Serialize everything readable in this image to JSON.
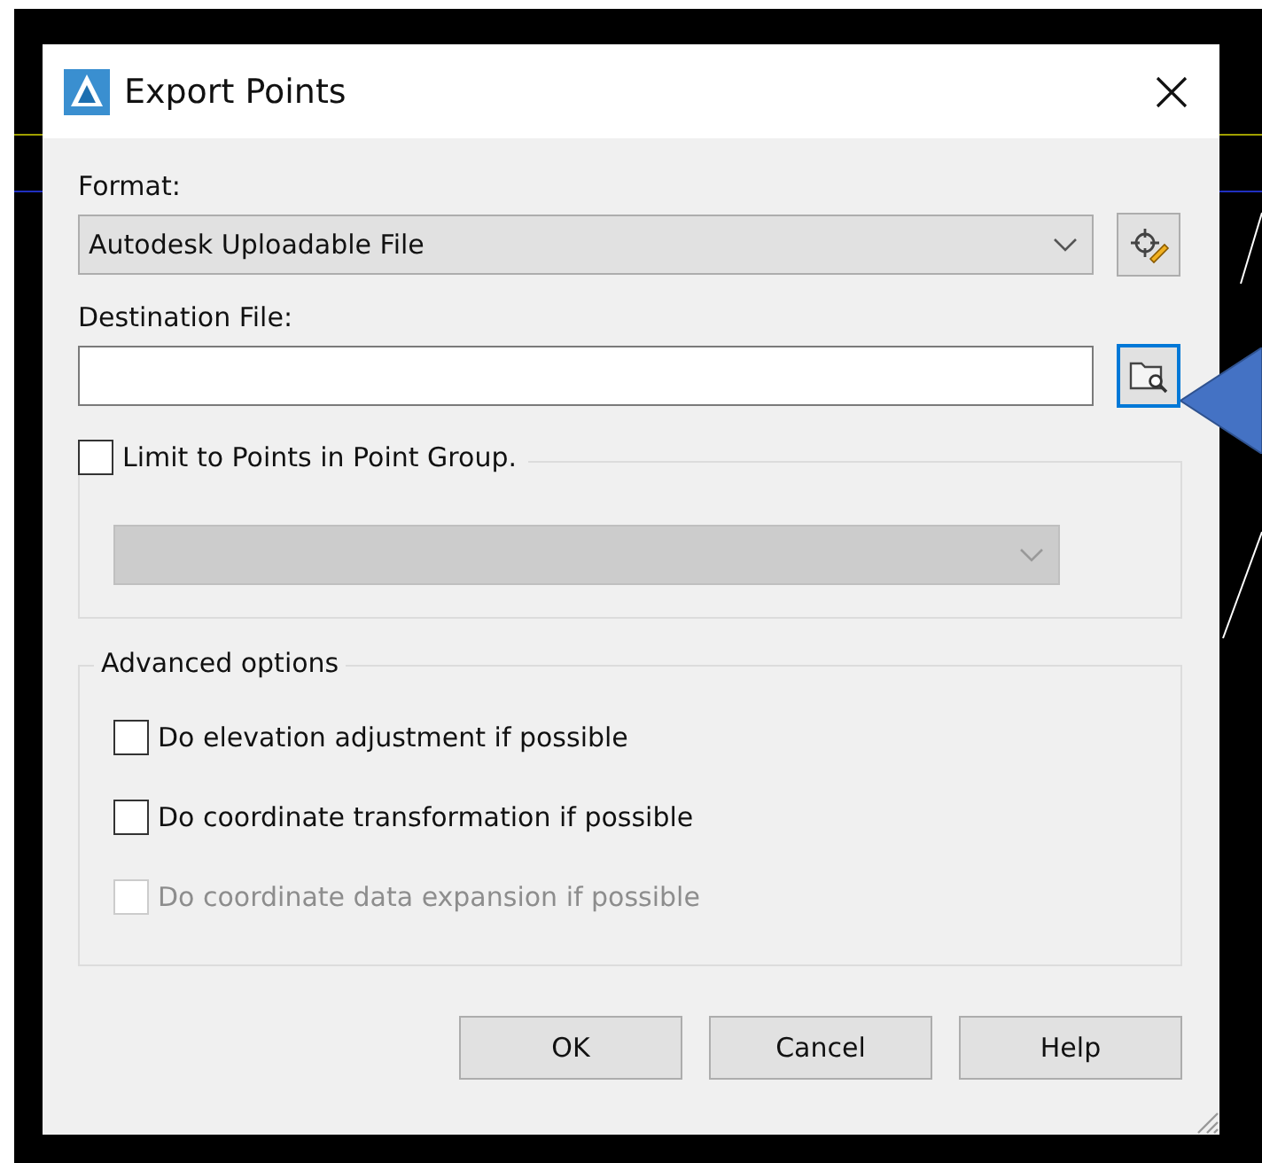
{
  "window": {
    "title": "Export Points"
  },
  "format": {
    "label": "Format:",
    "value": "Autodesk Uploadable File"
  },
  "destination": {
    "label": "Destination File:"
  },
  "point_group": {
    "label": "Limit to Points in Point Group.",
    "checked": false,
    "dropdown_disabled": true
  },
  "advanced_options": {
    "title": "Advanced options",
    "options": [
      {
        "label": "Do elevation adjustment if possible",
        "checked": false,
        "disabled": false
      },
      {
        "label": "Do coordinate transformation if possible",
        "checked": false,
        "disabled": false
      },
      {
        "label": "Do coordinate data expansion if possible",
        "checked": false,
        "disabled": true
      }
    ]
  },
  "buttons": [
    "OK",
    "Cancel",
    "Help"
  ]
}
